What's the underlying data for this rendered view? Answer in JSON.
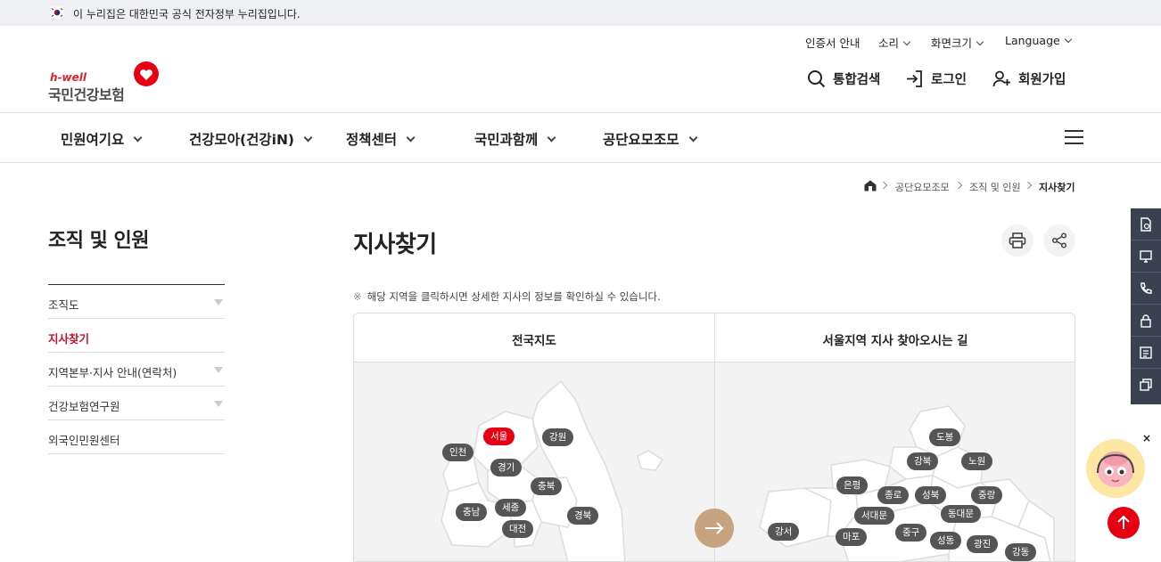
{
  "gov_banner": {
    "text": "이 누리집은 대한민국 공식 전자정부 누리집입니다."
  },
  "utility_links": [
    {
      "label": "인증서 안내",
      "dropdown": false
    },
    {
      "label": "소리",
      "dropdown": true
    },
    {
      "label": "화면크기",
      "dropdown": true
    },
    {
      "label": "Language",
      "dropdown": true
    }
  ],
  "logo": {
    "tagline": "h-well",
    "name": "국민건강보험"
  },
  "header_actions": [
    {
      "label": "통합검색",
      "icon": "search-icon"
    },
    {
      "label": "로그인",
      "icon": "login-icon"
    },
    {
      "label": "회원가입",
      "icon": "user-plus-icon"
    }
  ],
  "gnb": [
    {
      "label": "민원여기요"
    },
    {
      "label": "건강모아(건강iN)"
    },
    {
      "label": "정책센터"
    },
    {
      "label": "국민과함께"
    },
    {
      "label": "공단요모조모"
    }
  ],
  "breadcrumb": [
    "공단요모조모",
    "조직 및 인원",
    "지사찾기"
  ],
  "sidebar": {
    "title": "조직 및 인원",
    "items": [
      {
        "label": "조직도",
        "expandable": true,
        "active": false
      },
      {
        "label": "지사찾기",
        "expandable": false,
        "active": true
      },
      {
        "label": "지역본부·지사 안내(연락처)",
        "expandable": true,
        "active": false
      },
      {
        "label": "건강보험연구원",
        "expandable": true,
        "active": false
      },
      {
        "label": "외국인민원센터",
        "expandable": false,
        "active": false
      }
    ]
  },
  "main": {
    "title": "지사찾기",
    "notice_mark": "※",
    "notice": "해당 지역을 클릭하시면 상세한 지사의 정보를 확인하실 수 있습니다.",
    "tabs": [
      {
        "label": "전국지도"
      },
      {
        "label": "서울지역 지사 찾아오시는 길"
      }
    ],
    "national_regions": [
      {
        "label": "서울",
        "selected": true
      },
      {
        "label": "강원",
        "selected": false
      },
      {
        "label": "인천",
        "selected": false
      },
      {
        "label": "경기",
        "selected": false
      },
      {
        "label": "충북",
        "selected": false
      },
      {
        "label": "충남",
        "selected": false
      },
      {
        "label": "세종",
        "selected": false
      },
      {
        "label": "경북",
        "selected": false
      },
      {
        "label": "대전",
        "selected": false
      }
    ],
    "seoul_districts": [
      {
        "label": "도봉"
      },
      {
        "label": "강북"
      },
      {
        "label": "노원"
      },
      {
        "label": "은평"
      },
      {
        "label": "종로"
      },
      {
        "label": "성북"
      },
      {
        "label": "중랑"
      },
      {
        "label": "서대문"
      },
      {
        "label": "동대문"
      },
      {
        "label": "강서"
      },
      {
        "label": "마포"
      },
      {
        "label": "중구"
      },
      {
        "label": "성동"
      },
      {
        "label": "광진"
      },
      {
        "label": "강동"
      }
    ]
  },
  "quick_menu": [
    {
      "icon": "document-icon"
    },
    {
      "icon": "monitor-icon"
    },
    {
      "icon": "phone-icon"
    },
    {
      "icon": "lock-icon"
    },
    {
      "icon": "list-icon"
    },
    {
      "icon": "copy-icon"
    }
  ],
  "chatbot": {
    "close_label": "×"
  },
  "colors": {
    "brand_red": "#e60012",
    "active_red": "#c8102e",
    "quick_bg": "#3c4152",
    "arrow_btn": "#c8a37f"
  }
}
